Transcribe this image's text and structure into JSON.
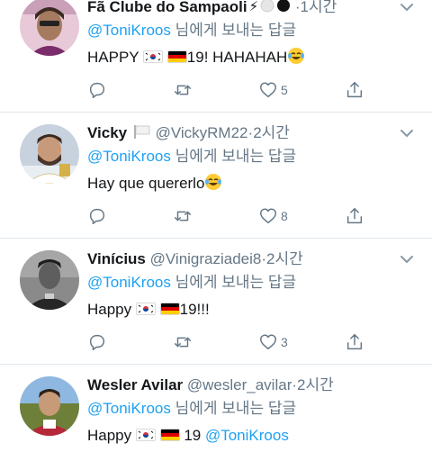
{
  "tweets": [
    {
      "name": "Fã Clube do Sampaoli",
      "handle": "",
      "dot": "·",
      "time": "1시간",
      "reply_prefix": "@ToniKroos",
      "reply_suffix": " 님에게 보내는 답글",
      "text_a": "HAPPY ",
      "text_b": "19! HAHAHAH",
      "likes": "5"
    },
    {
      "name": "Vicky",
      "handle": "@VickyRM22",
      "dot": "·",
      "time": "2시간",
      "reply_prefix": "@ToniKroos",
      "reply_suffix": " 님에게 보내는 답글",
      "text_a": "Hay que quererlo",
      "likes": "8"
    },
    {
      "name": "Vinícius",
      "handle": "@Vinigraziadei8",
      "dot": "·",
      "time": "2시간",
      "reply_prefix": "@ToniKroos",
      "reply_suffix": " 님에게 보내는 답글",
      "text_a": "Happy ",
      "text_b": "19!!!",
      "likes": "3"
    },
    {
      "name": "Wesler Avilar",
      "handle": "@wesler_avilar",
      "dot": "·",
      "time": "2시간",
      "reply_prefix": "@ToniKroos",
      "reply_suffix": " 님에게 보내는 답글",
      "text_a": "Happy ",
      "text_b": " 19 ",
      "text_mention": "@ToniKroos"
    }
  ],
  "icons": {
    "reply": "reply-icon",
    "retweet": "retweet-icon",
    "like": "heart-icon",
    "share": "share-icon",
    "more": "chevron-down-icon"
  },
  "colors": {
    "mention": "#1da1f2",
    "secondary_text": "#657786",
    "divider": "#e1e8ed"
  }
}
